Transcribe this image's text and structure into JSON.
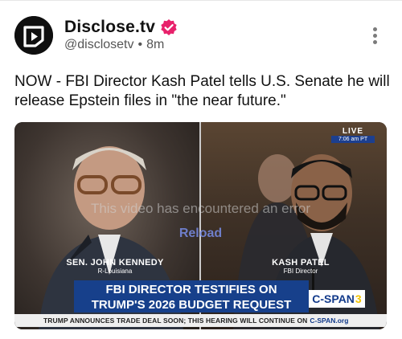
{
  "account": {
    "display_name": "Disclose.tv",
    "handle": "@disclosetv",
    "separator": "•",
    "time_ago": "8m",
    "avatar_icon": "disclose-tv-logo",
    "verified_icon": "verified-badge-icon"
  },
  "post": {
    "text": "NOW - FBI Director Kash Patel tells U.S. Senate he will release Epstein files in \"the near future.\""
  },
  "video": {
    "live_label": "LIVE",
    "live_time": "7:06 am PT",
    "error_message": "This video has encountered an error",
    "reload_label": "Reload",
    "left_person_name": "SEN. JOHN KENNEDY",
    "left_person_role": "R-Louisiana",
    "right_person_name": "KASH PATEL",
    "right_person_role": "FBI Director",
    "headline_line1": "FBI DIRECTOR TESTIFIES ON",
    "headline_line2": "TRUMP'S 2026 BUDGET REQUEST",
    "network_name": "C-SPAN",
    "network_channel": "3",
    "ticker_text": "TRUMP ANNOUNCES TRADE DEAL SOON; THIS HEARING WILL CONTINUE ON",
    "ticker_network": "C-SPAN.org"
  },
  "colors": {
    "verified_badge": "#e8216b",
    "headline_bar": "#17408b",
    "cspan_blue": "#123a8a",
    "cspan_yellow": "#f2c400"
  }
}
